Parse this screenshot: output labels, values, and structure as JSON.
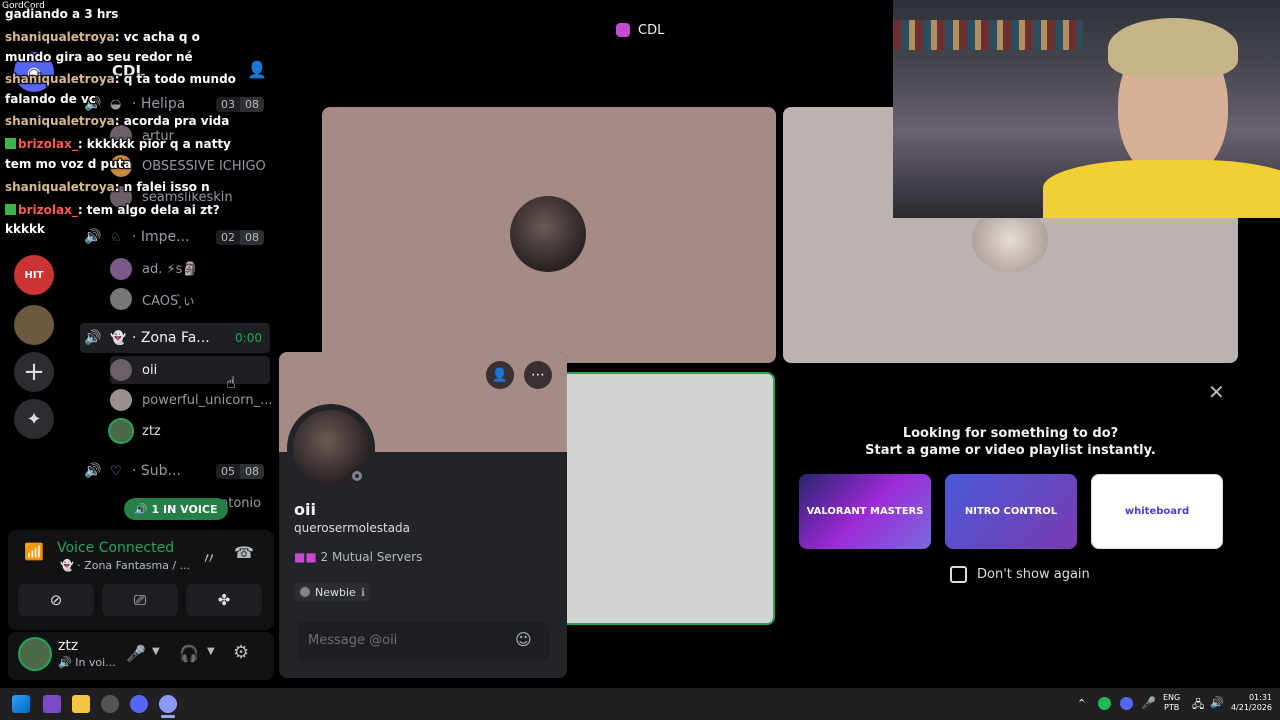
{
  "window_title": "CDL",
  "overlay_brand": "GordCord",
  "chat": [
    {
      "user": "",
      "text": "gadiando a 3 hrs"
    },
    {
      "user": "shaniqualetroya",
      "text": ": vc acha q o"
    },
    {
      "user": "",
      "text": "mundo gira ao seu redor né"
    },
    {
      "user": "shaniqualetroya",
      "text": ": q ta todo mundo"
    },
    {
      "user": "",
      "text": "falando de vc"
    },
    {
      "user": "shaniqualetroya",
      "text": ": acorda pra vida"
    },
    {
      "user": "brizolax_",
      "text": ": kkkkkk pior q a natty"
    },
    {
      "user": "",
      "text": "tem mo voz d puta"
    },
    {
      "user": "shaniqualetroya",
      "text": ": n falei isso n"
    },
    {
      "user": "brizolax_",
      "text": ": tem algo dela ai zt?"
    },
    {
      "user": "",
      "text": "kkkkk"
    }
  ],
  "server": {
    "name": "CDL"
  },
  "channels": [
    {
      "name": "Helipa",
      "count": "03",
      "limit": "08",
      "users": [
        "artur",
        "OBSESSIVE ICHIGO",
        "seamslikeskin"
      ]
    },
    {
      "name": "Impe...",
      "count": "02",
      "limit": "08",
      "users": [
        "ad. ⚡s🗿",
        "CAOS ̗̀ぃ"
      ]
    },
    {
      "name": "Zona Fa...",
      "timer": "0:00",
      "users": [
        "oii",
        "powerful_unicorn_...",
        "ztz"
      ]
    },
    {
      "name": "Sub...",
      "count": "05",
      "limit": "08",
      "users": [
        "ntonio"
      ]
    }
  ],
  "in_voice_badge": "1 IN VOICE",
  "voice": {
    "status": "Voice Connected",
    "channel": "Zona Fantasma / ..."
  },
  "user": {
    "name": "ztz",
    "status": "In voi..."
  },
  "popout": {
    "display_name": "oii",
    "username": "querosermolestada",
    "mutual": "2 Mutual Servers",
    "role": "Newbie",
    "message_placeholder": "Message @oii"
  },
  "activity": {
    "title_line1": "Looking for something to do?",
    "title_line2": "Start a game or video playlist instantly.",
    "cards": [
      "VALORANT MASTERS",
      "NITRO CONTROL",
      "whiteboard"
    ],
    "checkbox_label": "Don't show again"
  },
  "taskbar": {
    "lang1": "ENG",
    "lang2": "PTB",
    "time": "01:31",
    "date": "4/21/2026"
  },
  "colors": {
    "green": "#23a559",
    "bg": "#000000",
    "panel": "#111214",
    "tile_pink": "#a68b85",
    "tile_grey": "#bcb2b0"
  }
}
